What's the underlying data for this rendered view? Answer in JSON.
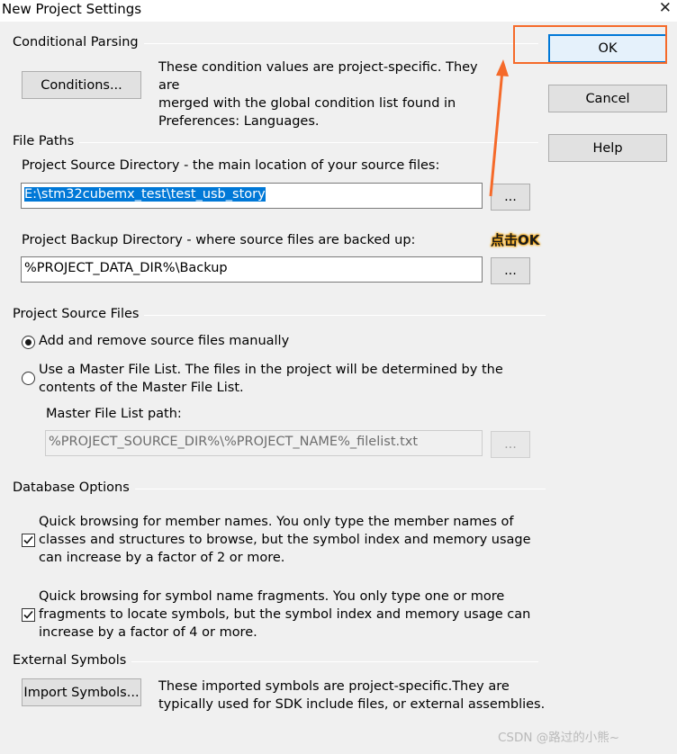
{
  "window": {
    "title": "New Project Settings",
    "close_glyph": "✕"
  },
  "buttons": {
    "ok": "OK",
    "cancel": "Cancel",
    "help": "Help"
  },
  "conditional": {
    "group_label": "Conditional Parsing",
    "button": "Conditions...",
    "description_lines": [
      "These condition values are project-specific.  They are",
      "merged with the global condition list found in",
      "Preferences: Languages."
    ]
  },
  "file_paths": {
    "group_label": "File Paths",
    "source_label": "Project Source Directory - the main location of your source files:",
    "source_value": "E:\\stm32cubemx_test\\test_usb_story",
    "backup_label": "Project Backup Directory - where source files are backed up:",
    "backup_value": "%PROJECT_DATA_DIR%\\Backup",
    "browse_label": "..."
  },
  "source_files": {
    "group_label": "Project Source Files",
    "option_manual": "Add and remove source files manually",
    "option_master_lines": [
      "Use a Master File List. The files in the project will be determined by the",
      "contents of the Master File List."
    ],
    "master_path_label": "Master File List path:",
    "master_path_value": "%PROJECT_SOURCE_DIR%\\%PROJECT_NAME%_filelist.txt",
    "selected": "manual"
  },
  "database": {
    "group_label": "Database Options",
    "option1_lines": [
      "Quick browsing for member names.  You only type the member names of",
      "classes and structures to browse, but the symbol index and memory usage",
      "can increase by a factor of 2 or more."
    ],
    "option1_checked": true,
    "option2_lines": [
      "Quick browsing for symbol name fragments.  You only type one or more",
      "fragments to locate symbols, but the symbol index and memory usage can",
      "increase by a factor of 4 or more."
    ],
    "option2_checked": true
  },
  "external": {
    "group_label": "External Symbols",
    "button": "Import Symbols...",
    "description_lines": [
      "These imported symbols are project-specific.They are",
      "typically used for SDK include files, or external assemblies."
    ]
  },
  "annotation": {
    "text": "点击OK",
    "color": "#f56a2a"
  },
  "watermark": "CSDN @路过的小熊~"
}
